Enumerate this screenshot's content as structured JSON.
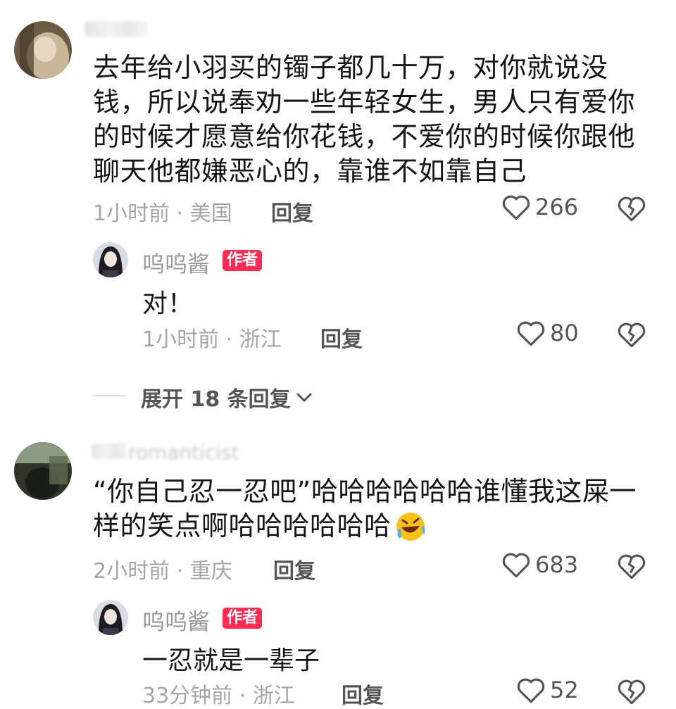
{
  "comments": [
    {
      "text_lines": [
        "去年给小羽买的镯子都几十万，对你就说没",
        "钱，所以说奉劝一些年轻女生，男人只有爱你",
        "的时候才愿意给你花钱，不爱你的时候你跟他",
        "聊天他都嫌恶心的，靠谁不如靠自己"
      ],
      "time_location": "1小时前 · 美国",
      "reply_label": "回复",
      "likes": "266",
      "reply": {
        "author": "呜呜酱",
        "author_tag": "作者",
        "text": "对！",
        "time_location": "1小时前 · 浙江",
        "reply_label": "回复",
        "likes": "80"
      },
      "expand_label": "展开 18 条回复"
    },
    {
      "username_partial": "romanticist",
      "text_lines": [
        "“你自己忍一忍吧”哈哈哈哈哈哈谁懂我这屎一",
        "样的笑点啊哈哈哈哈哈哈"
      ],
      "time_location": "2小时前 · 重庆",
      "reply_label": "回复",
      "likes": "683",
      "reply": {
        "author": "呜呜酱",
        "author_tag": "作者",
        "text": "一忍就是一辈子",
        "time_location": "33分钟前 · 浙江",
        "reply_label": "回复",
        "likes": "52"
      }
    }
  ],
  "icons": {
    "like": "heart-outline-icon",
    "dislike": "broken-heart-icon",
    "expand": "chevron-down-icon",
    "emoji": "laughing-crying-emoji"
  },
  "colors": {
    "author_tag_bg": "#fe2c55",
    "meta_text": "#a6a6a6"
  }
}
